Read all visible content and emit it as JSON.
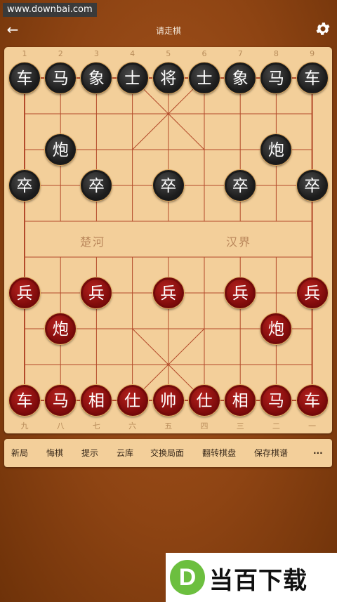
{
  "watermark": "www.downbai.com",
  "header": {
    "title": "请走棋"
  },
  "icons": {
    "back": "back-arrow-icon",
    "settings": "gear-icon",
    "more": "more-dots-icon"
  },
  "board": {
    "top_numbers": [
      "1",
      "2",
      "3",
      "4",
      "5",
      "6",
      "7",
      "8",
      "9"
    ],
    "bottom_numbers": [
      "九",
      "八",
      "七",
      "六",
      "五",
      "四",
      "三",
      "二",
      "一"
    ],
    "river_left": "楚河",
    "river_right": "汉界",
    "pieces": [
      {
        "side": "black",
        "label": "车",
        "col": 1,
        "row": 1
      },
      {
        "side": "black",
        "label": "马",
        "col": 2,
        "row": 1
      },
      {
        "side": "black",
        "label": "象",
        "col": 3,
        "row": 1
      },
      {
        "side": "black",
        "label": "士",
        "col": 4,
        "row": 1
      },
      {
        "side": "black",
        "label": "将",
        "col": 5,
        "row": 1
      },
      {
        "side": "black",
        "label": "士",
        "col": 6,
        "row": 1
      },
      {
        "side": "black",
        "label": "象",
        "col": 7,
        "row": 1
      },
      {
        "side": "black",
        "label": "马",
        "col": 8,
        "row": 1
      },
      {
        "side": "black",
        "label": "车",
        "col": 9,
        "row": 1
      },
      {
        "side": "black",
        "label": "炮",
        "col": 2,
        "row": 3
      },
      {
        "side": "black",
        "label": "炮",
        "col": 8,
        "row": 3
      },
      {
        "side": "black",
        "label": "卒",
        "col": 1,
        "row": 4
      },
      {
        "side": "black",
        "label": "卒",
        "col": 3,
        "row": 4
      },
      {
        "side": "black",
        "label": "卒",
        "col": 5,
        "row": 4
      },
      {
        "side": "black",
        "label": "卒",
        "col": 7,
        "row": 4
      },
      {
        "side": "black",
        "label": "卒",
        "col": 9,
        "row": 4
      },
      {
        "side": "red",
        "label": "兵",
        "col": 1,
        "row": 7
      },
      {
        "side": "red",
        "label": "兵",
        "col": 3,
        "row": 7
      },
      {
        "side": "red",
        "label": "兵",
        "col": 5,
        "row": 7
      },
      {
        "side": "red",
        "label": "兵",
        "col": 7,
        "row": 7
      },
      {
        "side": "red",
        "label": "兵",
        "col": 9,
        "row": 7
      },
      {
        "side": "red",
        "label": "炮",
        "col": 2,
        "row": 8
      },
      {
        "side": "red",
        "label": "炮",
        "col": 8,
        "row": 8
      },
      {
        "side": "red",
        "label": "车",
        "col": 1,
        "row": 10
      },
      {
        "side": "red",
        "label": "马",
        "col": 2,
        "row": 10
      },
      {
        "side": "red",
        "label": "相",
        "col": 3,
        "row": 10
      },
      {
        "side": "red",
        "label": "仕",
        "col": 4,
        "row": 10
      },
      {
        "side": "red",
        "label": "帅",
        "col": 5,
        "row": 10
      },
      {
        "side": "red",
        "label": "仕",
        "col": 6,
        "row": 10
      },
      {
        "side": "red",
        "label": "相",
        "col": 7,
        "row": 10
      },
      {
        "side": "red",
        "label": "马",
        "col": 8,
        "row": 10
      },
      {
        "side": "red",
        "label": "车",
        "col": 9,
        "row": 10
      }
    ]
  },
  "toolbar": {
    "new_game": "新局",
    "undo": "悔棋",
    "hint": "提示",
    "cloud": "云库",
    "swap": "交换局面",
    "flip": "翻转棋盘",
    "save": "保存棋谱",
    "more": "···"
  },
  "ad": {
    "logo_letter": "D",
    "text": "当百下载"
  },
  "colors": {
    "background": "#8e4413",
    "board": "#f3cf9a",
    "grid_line": "#b34a2a",
    "black_piece": "#1c1c1c",
    "red_piece": "#7e0b0b",
    "ad_logo": "#6cbf3f"
  }
}
